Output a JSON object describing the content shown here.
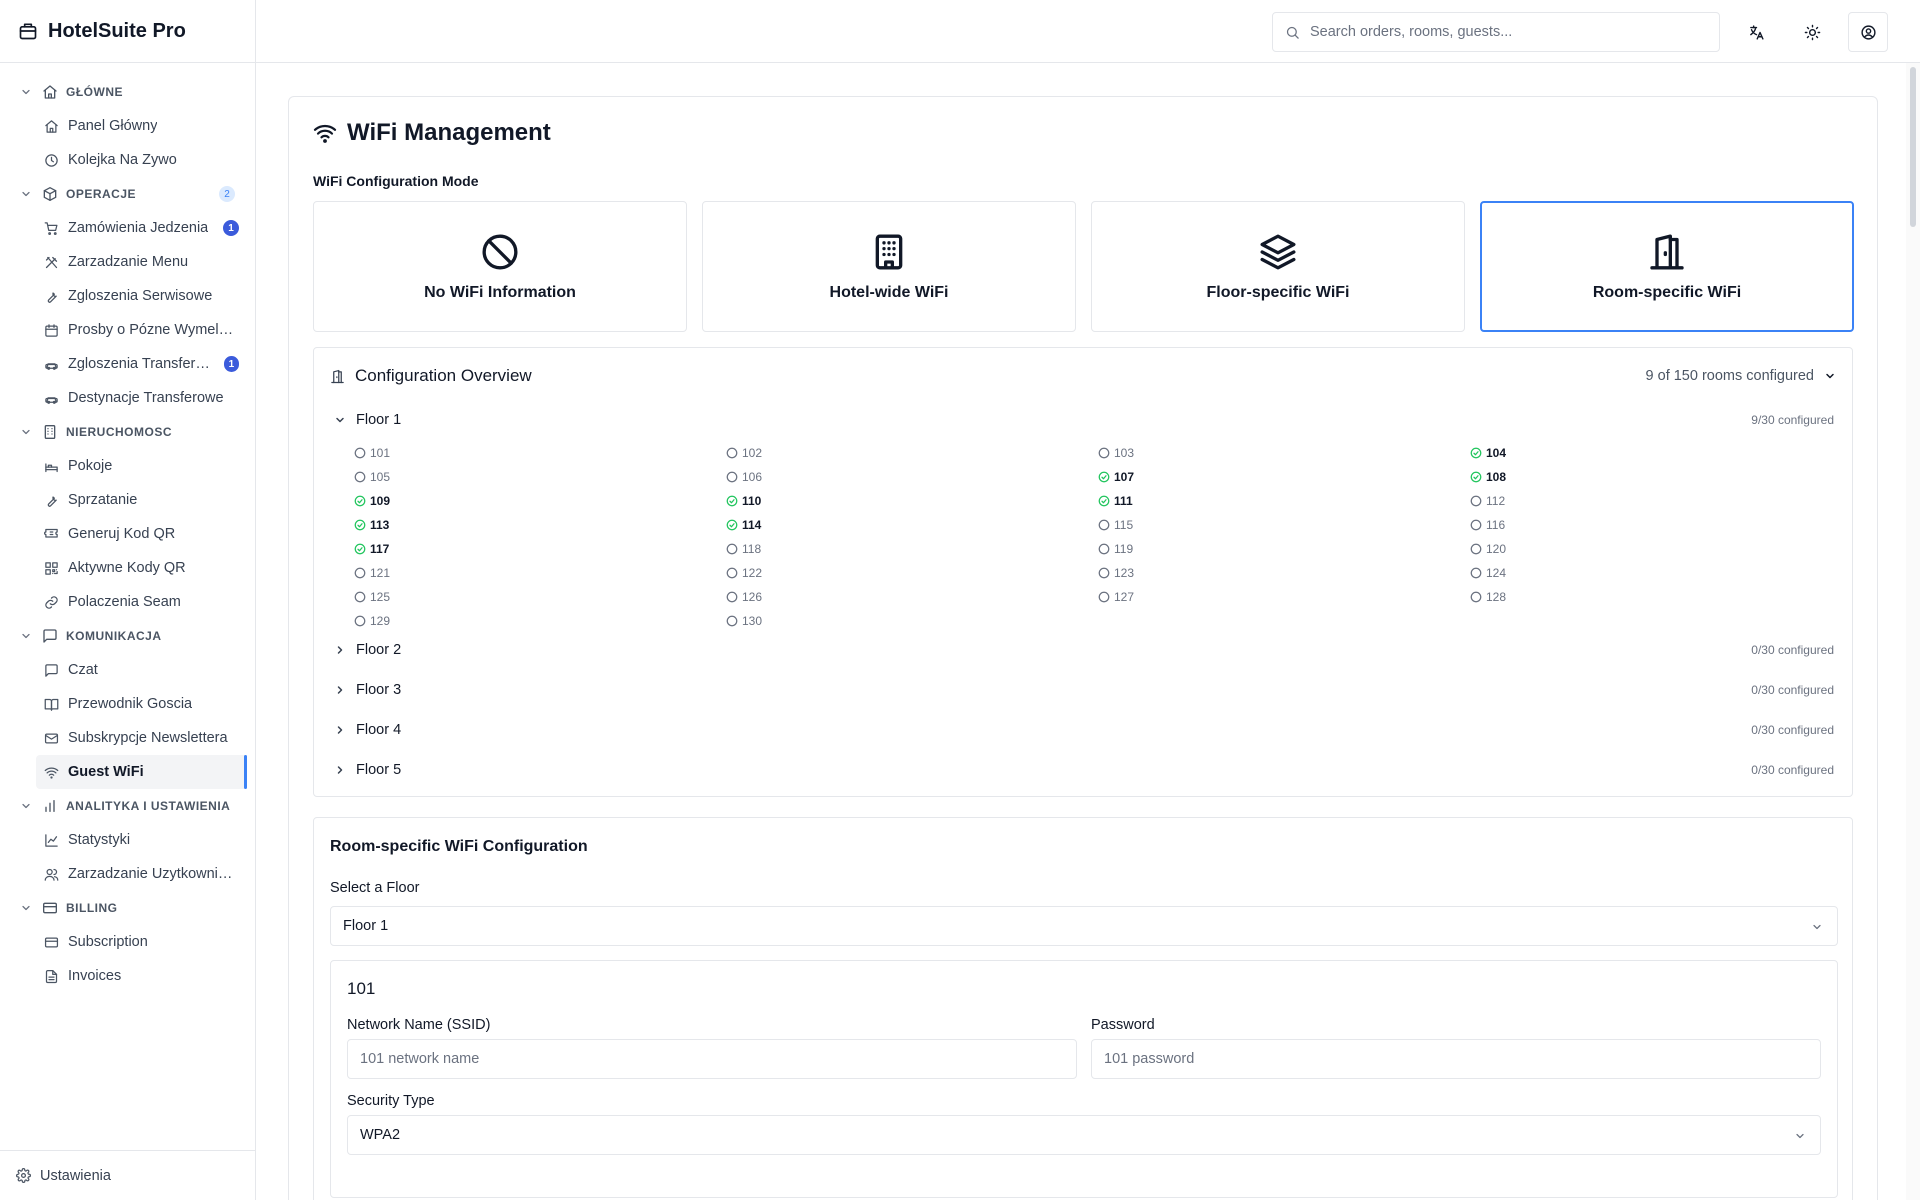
{
  "app": {
    "name": "HotelSuite Pro"
  },
  "sidebar": {
    "sections": [
      {
        "label": "GŁÓWNE",
        "icon": "home-icon",
        "badge": "",
        "items": [
          {
            "label": "Panel Główny",
            "icon": "home-icon",
            "badge": ""
          },
          {
            "label": "Kolejka Na Zywo",
            "icon": "clock-icon",
            "badge": ""
          }
        ]
      },
      {
        "label": "OPERACJE",
        "icon": "package-icon",
        "badge": "2",
        "items": [
          {
            "label": "Zamówienia Jedzenia",
            "icon": "cart-icon",
            "badge": "1"
          },
          {
            "label": "Zarzadzanie Menu",
            "icon": "utensils-icon",
            "badge": ""
          },
          {
            "label": "Zgloszenia Serwisowe",
            "icon": "wrench-icon",
            "badge": ""
          },
          {
            "label": "Prosby o Pózne Wymeldowanie",
            "icon": "calendar-icon",
            "badge": ""
          },
          {
            "label": "Zgloszenia Transferowe",
            "icon": "car-icon",
            "badge": "1"
          },
          {
            "label": "Destynacje Transferowe",
            "icon": "car-icon",
            "badge": ""
          }
        ]
      },
      {
        "label": "NIERUCHOMOSC",
        "icon": "building-icon",
        "badge": "",
        "items": [
          {
            "label": "Pokoje",
            "icon": "bed-icon",
            "badge": ""
          },
          {
            "label": "Sprzatanie",
            "icon": "wrench-icon",
            "badge": ""
          },
          {
            "label": "Generuj Kod QR",
            "icon": "ticket-icon",
            "badge": ""
          },
          {
            "label": "Aktywne Kody QR",
            "icon": "qr-icon",
            "badge": ""
          },
          {
            "label": "Polaczenia Seam",
            "icon": "link-icon",
            "badge": ""
          }
        ]
      },
      {
        "label": "KOMUNIKACJA",
        "icon": "chat-icon",
        "badge": "",
        "items": [
          {
            "label": "Czat",
            "icon": "chat-icon",
            "badge": ""
          },
          {
            "label": "Przewodnik Goscia",
            "icon": "book-icon",
            "badge": ""
          },
          {
            "label": "Subskrypcje Newslettera",
            "icon": "mail-icon",
            "badge": ""
          },
          {
            "label": "Guest WiFi",
            "icon": "wifi-icon",
            "badge": "",
            "active": true
          }
        ]
      },
      {
        "label": "ANALITYKA I USTAWIENIA",
        "icon": "bar-chart-icon",
        "badge": "",
        "items": [
          {
            "label": "Statystyki",
            "icon": "line-chart-icon",
            "badge": ""
          },
          {
            "label": "Zarzadzanie Uzytkownikami",
            "icon": "users-icon",
            "badge": ""
          }
        ]
      },
      {
        "label": "BILLING",
        "icon": "credit-card-icon",
        "badge": "",
        "items": [
          {
            "label": "Subscription",
            "icon": "credit-card-icon",
            "badge": ""
          },
          {
            "label": "Invoices",
            "icon": "file-icon",
            "badge": ""
          }
        ]
      }
    ],
    "settings_label": "Ustawienia"
  },
  "topbar": {
    "search_placeholder": "Search orders, rooms, guests..."
  },
  "page": {
    "title": "WiFi Management",
    "mode_label": "WiFi Configuration Mode",
    "modes": [
      {
        "label": "No WiFi Information",
        "icon": "ban-icon",
        "selected": false
      },
      {
        "label": "Hotel-wide WiFi",
        "icon": "building-icon",
        "selected": false
      },
      {
        "label": "Floor-specific WiFi",
        "icon": "layers-icon",
        "selected": false
      },
      {
        "label": "Room-specific WiFi",
        "icon": "door-icon",
        "selected": true
      }
    ]
  },
  "overview": {
    "title": "Configuration Overview",
    "summary": "9 of 150 rooms configured",
    "floors": [
      {
        "name": "Floor 1",
        "status": "9/30 configured",
        "expanded": true
      },
      {
        "name": "Floor 2",
        "status": "0/30 configured",
        "expanded": false
      },
      {
        "name": "Floor 3",
        "status": "0/30 configured",
        "expanded": false
      },
      {
        "name": "Floor 4",
        "status": "0/30 configured",
        "expanded": false
      },
      {
        "name": "Floor 5",
        "status": "0/30 configured",
        "expanded": false
      }
    ],
    "floor1_rooms": [
      {
        "n": "101",
        "ok": false
      },
      {
        "n": "102",
        "ok": false
      },
      {
        "n": "103",
        "ok": false
      },
      {
        "n": "104",
        "ok": true
      },
      {
        "n": "105",
        "ok": false
      },
      {
        "n": "106",
        "ok": false
      },
      {
        "n": "107",
        "ok": true
      },
      {
        "n": "108",
        "ok": true
      },
      {
        "n": "109",
        "ok": true
      },
      {
        "n": "110",
        "ok": true
      },
      {
        "n": "111",
        "ok": true
      },
      {
        "n": "112",
        "ok": false
      },
      {
        "n": "113",
        "ok": true
      },
      {
        "n": "114",
        "ok": true
      },
      {
        "n": "115",
        "ok": false
      },
      {
        "n": "116",
        "ok": false
      },
      {
        "n": "117",
        "ok": true
      },
      {
        "n": "118",
        "ok": false
      },
      {
        "n": "119",
        "ok": false
      },
      {
        "n": "120",
        "ok": false
      },
      {
        "n": "121",
        "ok": false
      },
      {
        "n": "122",
        "ok": false
      },
      {
        "n": "123",
        "ok": false
      },
      {
        "n": "124",
        "ok": false
      },
      {
        "n": "125",
        "ok": false
      },
      {
        "n": "126",
        "ok": false
      },
      {
        "n": "127",
        "ok": false
      },
      {
        "n": "128",
        "ok": false
      },
      {
        "n": "129",
        "ok": false
      },
      {
        "n": "130",
        "ok": false
      }
    ]
  },
  "config": {
    "title": "Room-specific WiFi Configuration",
    "floor_select_label": "Select a Floor",
    "floor_selected": "Floor 1",
    "room": {
      "number": "101",
      "ssid_label": "Network Name (SSID)",
      "ssid_placeholder": "101 network name",
      "password_label": "Password",
      "password_placeholder": "101 password",
      "security_label": "Security Type",
      "security_value": "WPA2"
    }
  },
  "colors": {
    "accent": "#3b82f6",
    "success": "#22c55e",
    "badge": "#3b5bdb"
  }
}
